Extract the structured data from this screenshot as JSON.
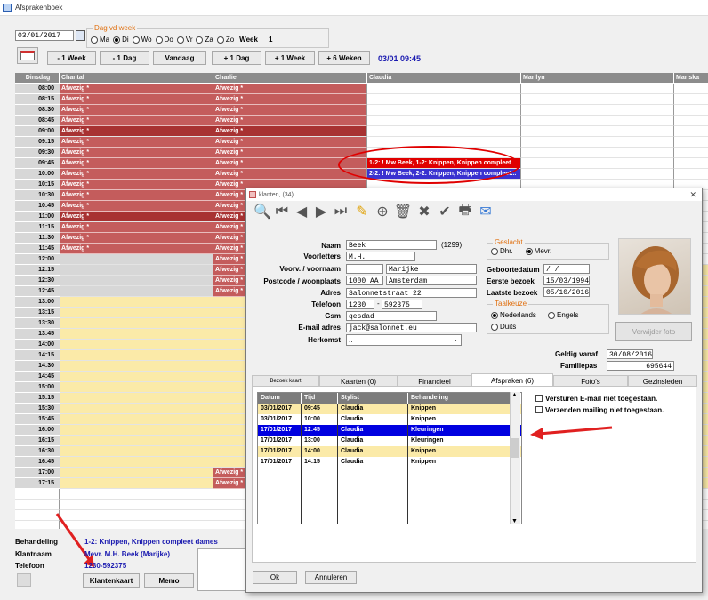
{
  "window": {
    "title": "Afsprakenboek"
  },
  "toolbar": {
    "date": "03/01/2017",
    "day_group_label": "Dag vd week",
    "days": [
      {
        "label": "Ma",
        "on": false
      },
      {
        "label": "Di",
        "on": true
      },
      {
        "label": "Wo",
        "on": false
      },
      {
        "label": "Do",
        "on": false
      },
      {
        "label": "Vr",
        "on": false
      },
      {
        "label": "Za",
        "on": false
      },
      {
        "label": "Zo",
        "on": false
      }
    ],
    "week_label": "Week",
    "week_number": "1",
    "nav_buttons": [
      "- 1 Week",
      "- 1 Dag",
      "Vandaag",
      "+ 1 Dag",
      "+ 1 Week",
      "+ 6 Weken"
    ],
    "current_datetime": "03/01  09:45"
  },
  "schedule": {
    "columns": [
      "Dinsdag",
      "Chantal",
      "Charlie",
      "Claudia",
      "Marilyn",
      "Mariska"
    ],
    "times": [
      "08:00",
      "08:15",
      "08:30",
      "08:45",
      "09:00",
      "09:15",
      "09:30",
      "09:45",
      "10:00",
      "10:15",
      "10:30",
      "10:45",
      "11:00",
      "11:15",
      "11:30",
      "11:45",
      "12:00",
      "12:15",
      "12:30",
      "12:45",
      "13:00",
      "13:15",
      "13:30",
      "13:45",
      "14:00",
      "14:15",
      "14:30",
      "14:45",
      "15:00",
      "15:15",
      "15:30",
      "15:45",
      "16:00",
      "16:15",
      "16:30",
      "16:45",
      "17:00",
      "17:15"
    ],
    "absent_label": "Afwezig *",
    "appointments": [
      {
        "row": 7,
        "text": "1-2: ! Mw Beek, 1-2: Knippen, Knippen compleet"
      },
      {
        "row": 8,
        "text": "2-2: ! Mw Beek, 2-2: Knippen, Knippen compleet..."
      }
    ]
  },
  "footer": {
    "behandeling_label": "Behandeling",
    "behandeling_value": "1-2: Knippen, Knippen compleet dames",
    "klantnaam_label": "Klantnaam",
    "klantnaam_value": "Mevr. M.H. Beek (Marijke)",
    "telefoon_label": "Telefoon",
    "telefoon_value": "1230-592375",
    "klantenkaart_button": "Klantenkaart",
    "memo_button": "Memo"
  },
  "dialog": {
    "title": "klanten, (34)",
    "labels": {
      "naam": "Naam",
      "voorletters": "Voorletters",
      "voornaam": "Voorv. / voornaam",
      "postcode": "Postcode / woonplaats",
      "adres": "Adres",
      "telefoon": "Telefoon",
      "gsm": "Gsm",
      "email": "E-mail adres",
      "herkomst": "Herkomst"
    },
    "values": {
      "naam": "Beek",
      "klantnr": "(1299)",
      "voorletters": "M.H.",
      "voorvoegsel": "",
      "voornaam": "Marijke",
      "postcode": "1000 AA",
      "woonplaats": "Amsterdam",
      "adres": "Salonnetstraat 22",
      "tel1": "1230",
      "tel2": "592375",
      "gsm": "qesdad",
      "email": "jack@salonnet.eu",
      "herkomst": ".."
    },
    "gender": {
      "label": "Geslacht",
      "options": [
        {
          "label": "Dhr.",
          "on": false
        },
        {
          "label": "Mevr.",
          "on": true
        }
      ]
    },
    "dates": {
      "geboorte_label": "Geboortedatum",
      "geboorte_value": "  /  /",
      "eerste_label": "Eerste bezoek",
      "eerste_value": "15/03/1994",
      "laatste_label": "Laatste bezoek",
      "laatste_value": "05/10/2016"
    },
    "language": {
      "label": "Taalkeuze",
      "options": [
        {
          "label": "Nederlands",
          "on": true
        },
        {
          "label": "Engels",
          "on": false
        },
        {
          "label": "Duits",
          "on": false
        }
      ]
    },
    "photo_button": "Verwijder foto",
    "geldig_label": "Geldig vanaf",
    "geldig_value": "30/08/2016",
    "familiepas_label": "Familiepas",
    "familiepas_value": "695644",
    "tabs": [
      "Bezoek kaart",
      "Kaarten (0)",
      "Financieel",
      "Afspraken (6)",
      "Foto's",
      "Gezinsleden"
    ],
    "list": {
      "headers": [
        "Datum",
        "Tijd",
        "Stylist",
        "Behandeling"
      ],
      "rows": [
        [
          "03/01/2017",
          "09:45",
          "Claudia",
          "Knippen"
        ],
        [
          "03/01/2017",
          "10:00",
          "Claudia",
          "Knippen"
        ],
        [
          "17/01/2017",
          "12:45",
          "Claudia",
          "Kleuringen"
        ],
        [
          "17/01/2017",
          "13:00",
          "Claudia",
          "Kleuringen"
        ],
        [
          "17/01/2017",
          "14:00",
          "Claudia",
          "Knippen"
        ],
        [
          "17/01/2017",
          "14:15",
          "Claudia",
          "Knippen"
        ]
      ],
      "selected_row": 2
    },
    "checks": [
      "Versturen E-mail niet toegestaan.",
      "Verzenden mailing niet toegestaan."
    ],
    "ok_button": "Ok",
    "cancel_button": "Annuleren"
  },
  "colors": {
    "absent": "#c45c5c",
    "appointment1": "#e00000",
    "appointment2": "#3a32d0",
    "highlight_oval": "#e00000",
    "arrow": "#e02020",
    "selected_row": "#0000e0"
  }
}
